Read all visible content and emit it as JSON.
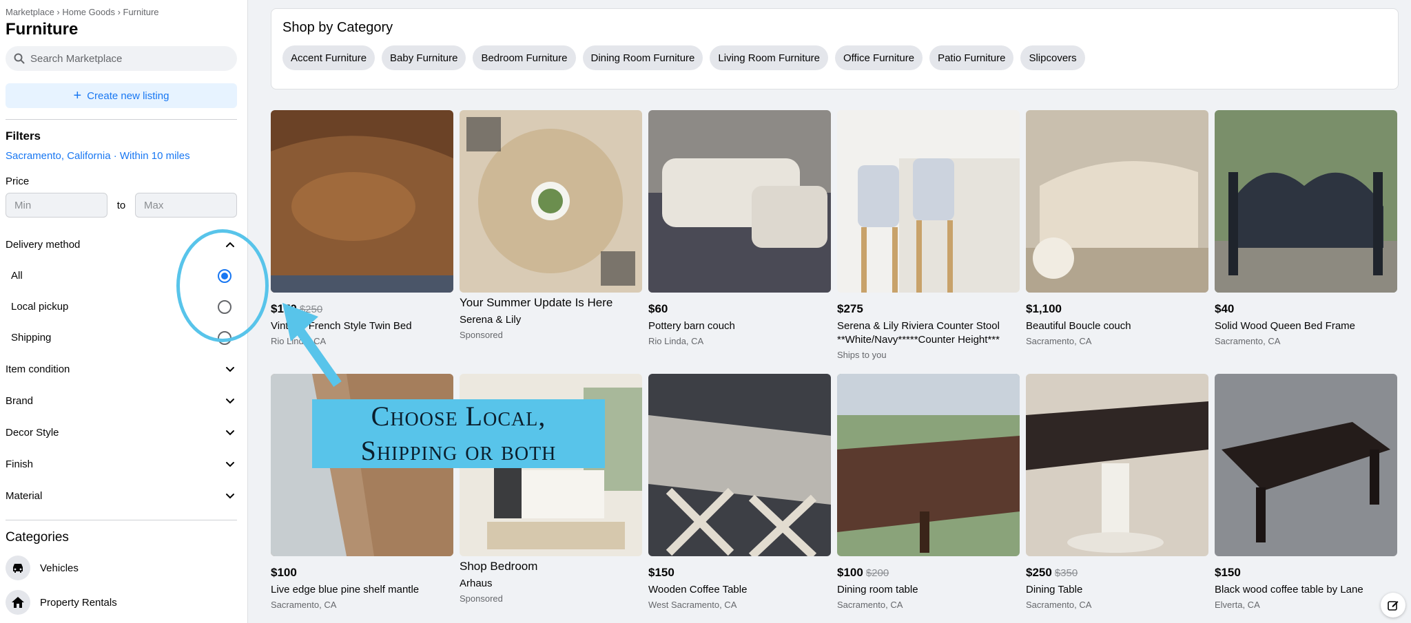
{
  "sidebar": {
    "breadcrumb": "Marketplace › Home Goods › Furniture",
    "title": "Furniture",
    "search_placeholder": "Search Marketplace",
    "create_label": "Create new listing",
    "filters_title": "Filters",
    "location": "Sacramento, California · Within 10 miles",
    "price_label": "Price",
    "price_min_placeholder": "Min",
    "price_to": "to",
    "price_max_placeholder": "Max",
    "delivery_label": "Delivery method",
    "delivery_options": [
      {
        "label": "All",
        "selected": true
      },
      {
        "label": "Local pickup",
        "selected": false
      },
      {
        "label": "Shipping",
        "selected": false
      }
    ],
    "filters": [
      "Item condition",
      "Brand",
      "Decor Style",
      "Finish",
      "Material"
    ],
    "categories_title": "Categories",
    "categories": [
      {
        "label": "Vehicles",
        "icon": "car-icon"
      },
      {
        "label": "Property Rentals",
        "icon": "house-icon"
      }
    ]
  },
  "shop": {
    "title": "Shop by Category",
    "chips": [
      "Accent Furniture",
      "Baby Furniture",
      "Bedroom Furniture",
      "Dining Room Furniture",
      "Living Room Furniture",
      "Office Furniture",
      "Patio Furniture",
      "Slipcovers"
    ]
  },
  "listings": [
    {
      "price": "$170",
      "old": "$250",
      "title": "Vintage French Style Twin Bed",
      "loc": "Rio Linda, CA"
    },
    {
      "price": "",
      "old": "",
      "title": "Your Summer Update Is Here",
      "title2": "Serena & Lily",
      "loc": "Sponsored",
      "sponsored": true
    },
    {
      "price": "$60",
      "old": "",
      "title": "Pottery barn couch",
      "loc": "Rio Linda, CA"
    },
    {
      "price": "$275",
      "old": "",
      "title": "Serena & Lily Riviera Counter Stool **White/Navy*****Counter Height***",
      "loc": "Ships to you"
    },
    {
      "price": "$1,100",
      "old": "",
      "title": "Beautiful Boucle couch",
      "loc": "Sacramento, CA"
    },
    {
      "price": "$40",
      "old": "",
      "title": "Solid Wood Queen Bed Frame",
      "loc": "Sacramento, CA"
    },
    {
      "price": "$100",
      "old": "",
      "title": "Live edge blue pine shelf mantle",
      "loc": "Sacramento, CA"
    },
    {
      "price": "",
      "old": "",
      "title": "Shop Bedroom",
      "title2": "Arhaus",
      "loc": "Sponsored",
      "sponsored": true
    },
    {
      "price": "$150",
      "old": "",
      "title": "Wooden Coffee Table",
      "loc": "West Sacramento, CA"
    },
    {
      "price": "$100",
      "old": "$200",
      "title": "Dining room table",
      "loc": "Sacramento, CA"
    },
    {
      "price": "$250",
      "old": "$350",
      "title": "Dining Table",
      "loc": "Sacramento, CA"
    },
    {
      "price": "$150",
      "old": "",
      "title": "Black wood coffee table by Lane",
      "loc": "Elverta, CA"
    }
  ],
  "callout": {
    "line1": "Choose Local,",
    "line2": "Shipping or both"
  },
  "colors": {
    "accent": "#1877f2",
    "callout": "#58c4ea"
  }
}
